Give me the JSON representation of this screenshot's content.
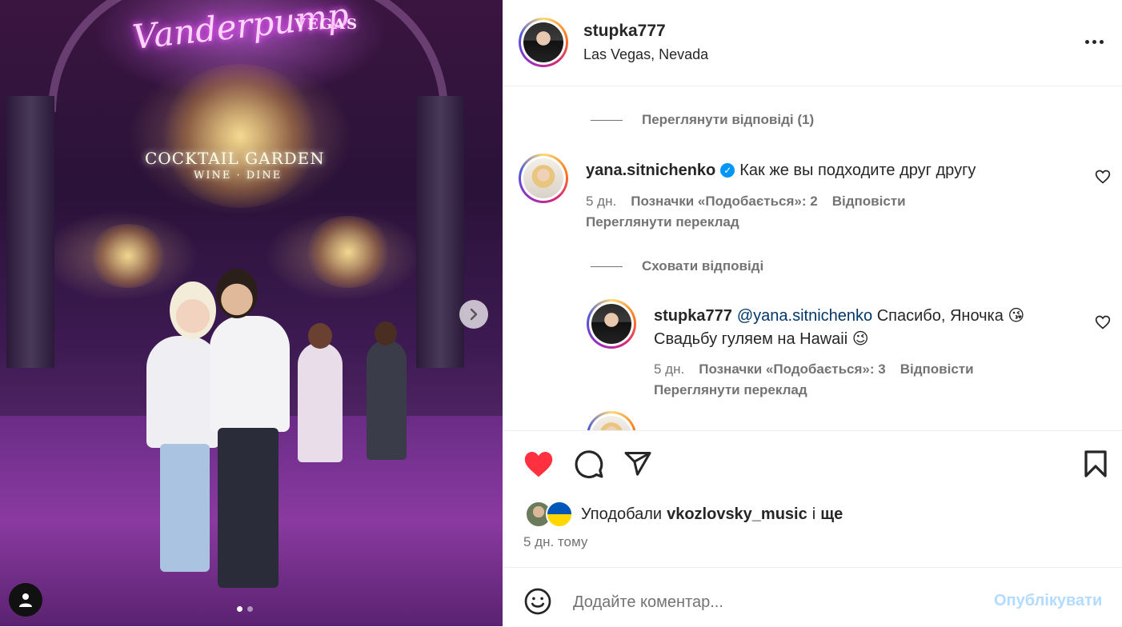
{
  "post": {
    "neon_sign": "Vanderpump",
    "neon_sub": "VEGAS",
    "venue_sign": "COCKTAIL GARDEN",
    "venue_sub": "WINE · DINE",
    "carousel_total": 2,
    "carousel_active": 1
  },
  "header": {
    "username": "stupka777",
    "location": "Las Vegas, Nevada"
  },
  "comments": {
    "view_replies": "Переглянути відповіді (1)",
    "hide_replies": "Сховати відповіді",
    "items": [
      {
        "username": "yana.sitnichenko",
        "verified_mark": "✓",
        "text": "Как же вы подходите друг другу",
        "age": "5 дн.",
        "likes": "Позначки «Подобається»: 2",
        "reply": "Відповісти",
        "translate": "Переглянути переклад"
      },
      {
        "username": "stupka777",
        "mention": "@yana.sitnichenko",
        "text": "Спасибо, Яночка 😘",
        "text2": "Свадьбу гуляем на Hawaii 😉",
        "age": "5 дн.",
        "likes": "Позначки «Подобається»: 3",
        "reply": "Відповісти",
        "translate": "Переглянути переклад"
      }
    ]
  },
  "likes": {
    "prefix": "Уподобали",
    "user": "vkozlovsky_music",
    "and": "і",
    "more": "ще"
  },
  "timestamp": "5 дн. тому",
  "composer": {
    "placeholder": "Додайте коментар...",
    "post_label": "Опублікувати"
  },
  "colors": {
    "like_red": "#ff3040",
    "link_blue": "#00376b",
    "verified_blue": "#0095f6",
    "muted": "#737373",
    "post_disabled": "#b3dbff"
  },
  "icons": {
    "like": "heart-filled-icon",
    "comment": "comment-bubble-icon",
    "share": "paper-plane-icon",
    "save": "bookmark-icon",
    "more": "more-horizontal-icon",
    "emoji": "smiley-icon",
    "tag": "user-tag-icon",
    "next": "chevron-right-icon"
  }
}
